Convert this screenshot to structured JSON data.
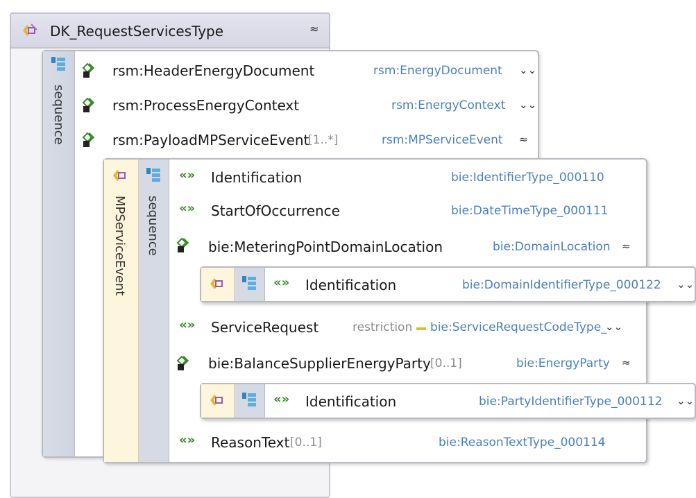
{
  "root": {
    "name": "DK_RequestServicesType",
    "collapse_icon": "chevron-up-double"
  },
  "sequence_label": "sequence",
  "outer_elements": [
    {
      "name": "rsm:HeaderEnergyDocument",
      "mult": "",
      "type": "rsm:EnergyDocument",
      "chevron": "down"
    },
    {
      "name": "rsm:ProcessEnergyContext",
      "mult": "",
      "type": "rsm:EnergyContext",
      "chevron": "down"
    },
    {
      "name": "rsm:PayloadMPServiceEvent",
      "mult": "[1..*]",
      "type": "rsm:MPServiceEvent",
      "chevron": "up"
    }
  ],
  "inner_complex": {
    "name": "MPServiceEvent",
    "sequence_label": "sequence"
  },
  "inner_elements": [
    {
      "name": "Identification",
      "type": "bie:IdentifierType_000110"
    },
    {
      "name": "StartOfOccurrence",
      "type": "bie:DateTimeType_000111"
    },
    {
      "name": "bie:MeteringPointDomainLocation",
      "type": "bie:DomainLocation",
      "chevron": "up"
    },
    {
      "name": "ServiceRequest",
      "restriction": "restriction",
      "type": "bie:ServiceRequestCodeType_",
      "chevron": "down"
    },
    {
      "name": "bie:BalanceSupplierEnergyParty",
      "mult": "[0..1]",
      "type": "bie:EnergyParty",
      "chevron": "up"
    },
    {
      "name": "ReasonText",
      "mult": "[0..1]",
      "type": "bie:ReasonTextType_000114"
    }
  ],
  "nested": [
    {
      "name": "Identification",
      "type": "bie:DomainIdentifierType_000122",
      "chevron": "down"
    },
    {
      "name": "Identification",
      "type": "bie:PartyIdentifierType_000112",
      "chevron": "down"
    }
  ],
  "colors": {
    "type_link": "#4a7fbf",
    "element_icon": "#3a8a2a",
    "complex_accent": "#fdf5dc",
    "sequence_strip": "#d6dae4"
  }
}
